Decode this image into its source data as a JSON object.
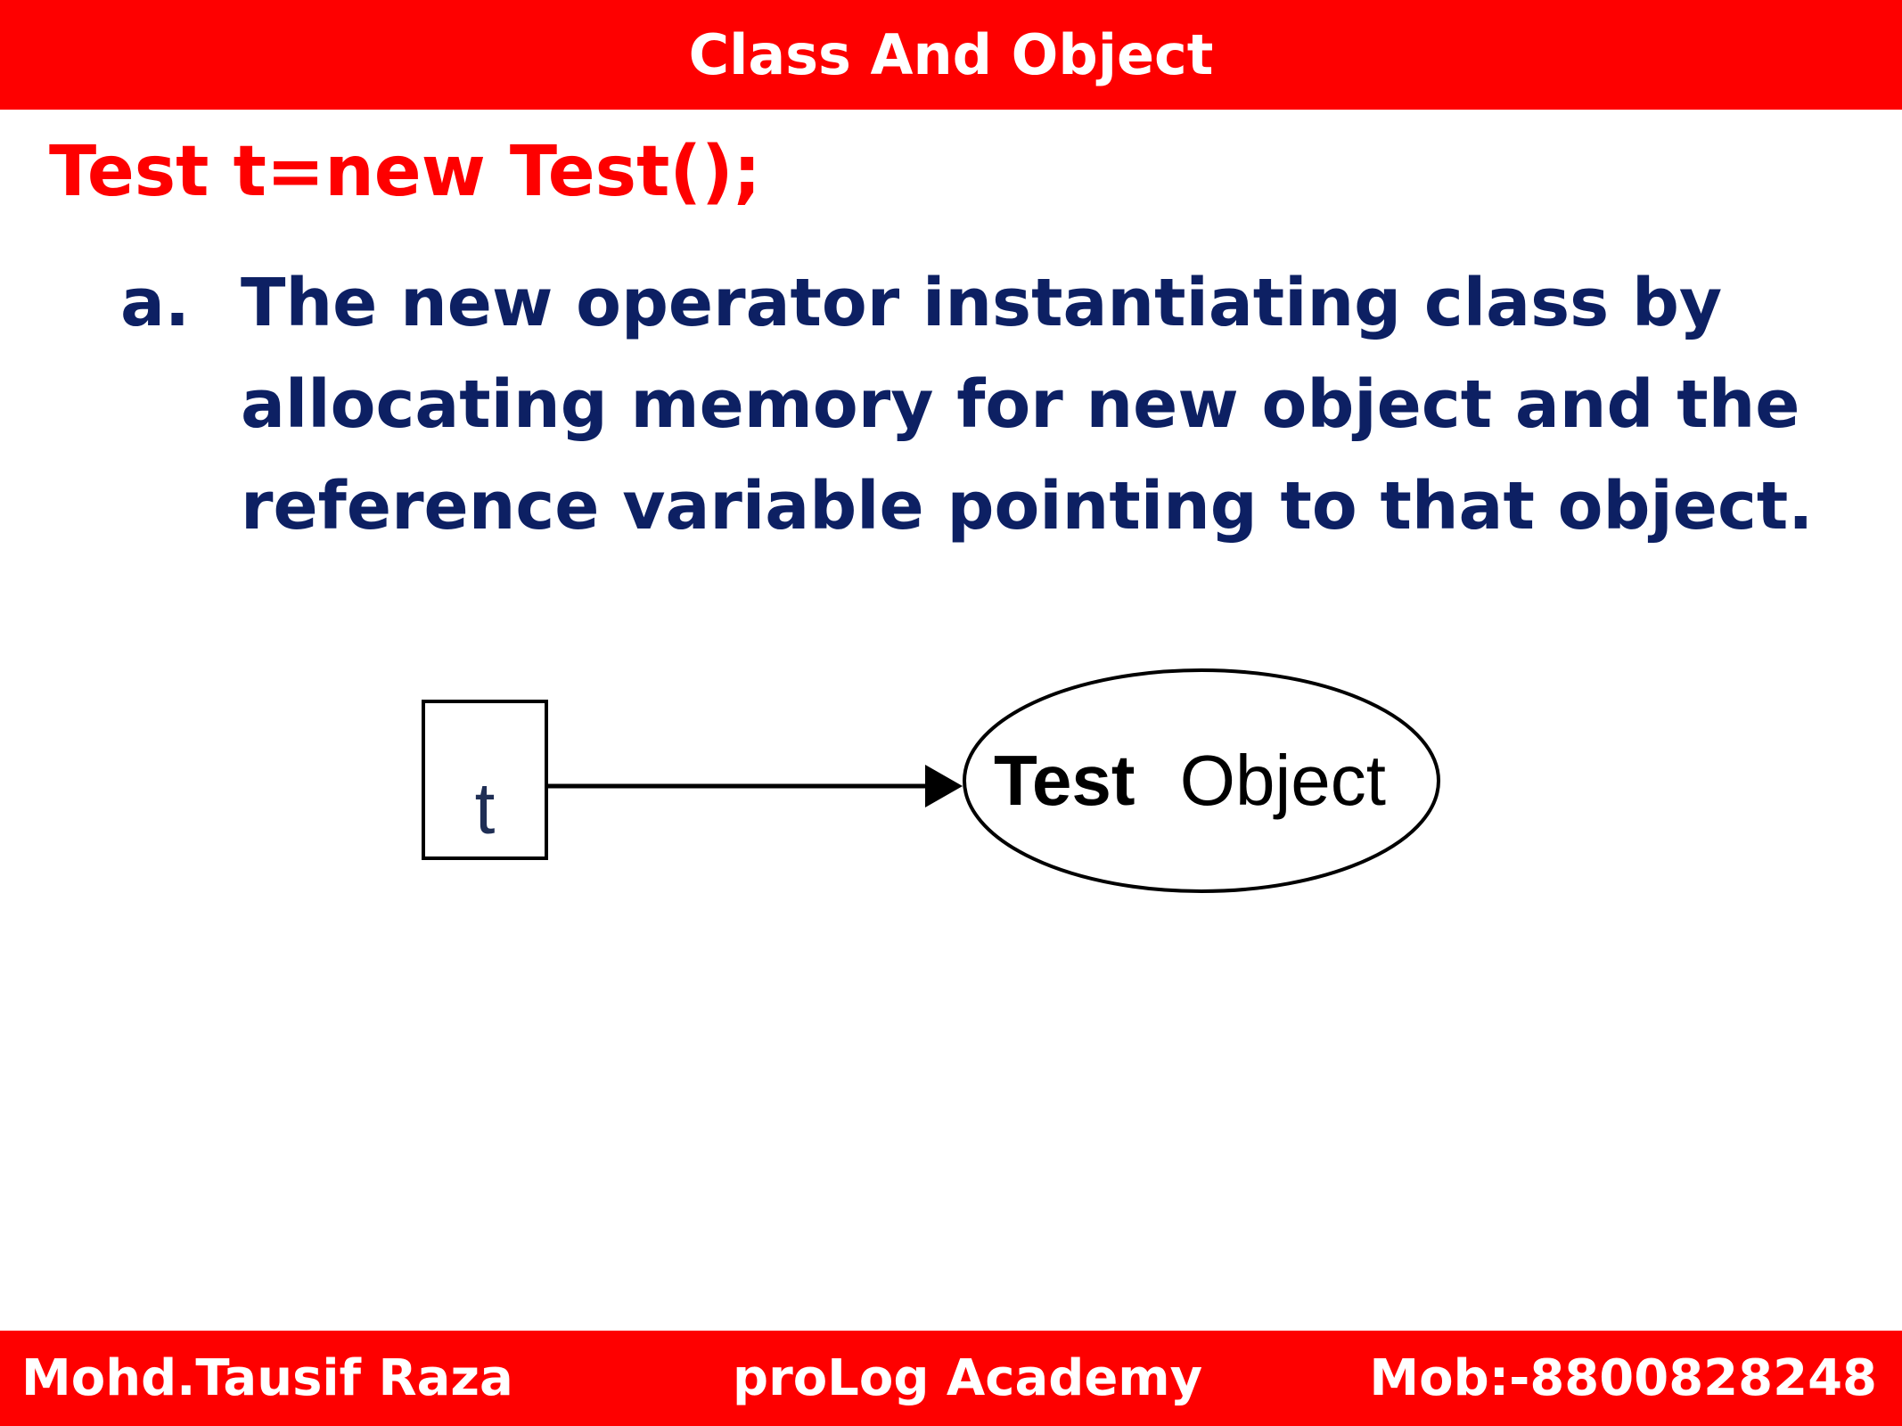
{
  "header": {
    "title": "Class And Object"
  },
  "content": {
    "code_line": "Test t=new Test();",
    "points": [
      {
        "marker": "a.",
        "lines": [
          "The new operator instantiating class by",
          "allocating memory for new object and the",
          "reference variable pointing to that object."
        ]
      }
    ]
  },
  "diagram": {
    "reference_label": "t",
    "object_label_bold": "Test",
    "object_label_plain": "Object"
  },
  "footer": {
    "author": "Mohd.Tausif Raza",
    "academy": "proLog Academy",
    "mobile": "Mob:-8800828248"
  },
  "colors": {
    "bar_red": "#fe0000",
    "code_red": "#fe0000",
    "text_navy": "#0d2063",
    "white": "#ffffff"
  }
}
